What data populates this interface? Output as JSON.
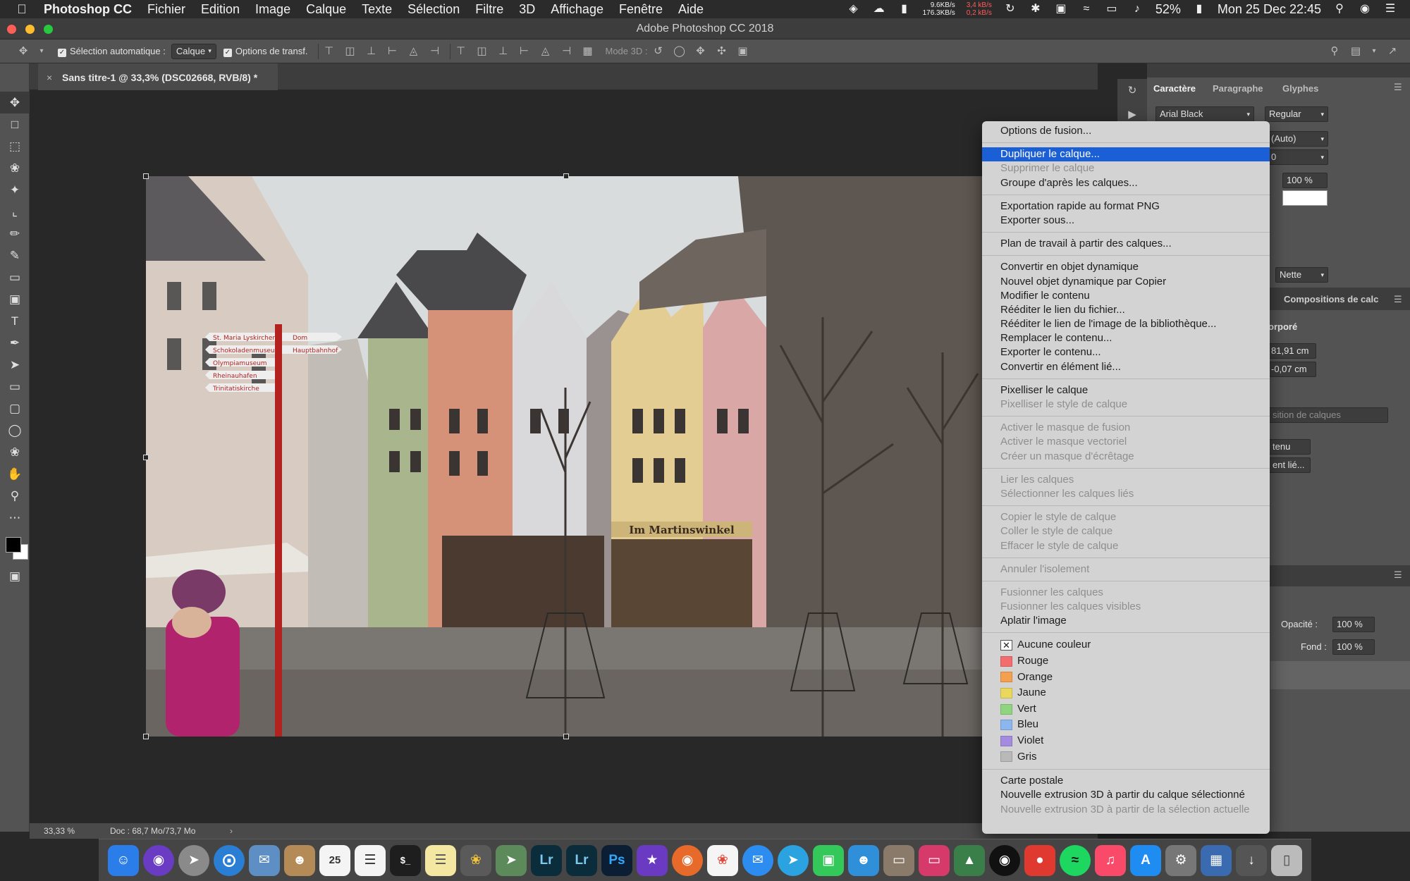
{
  "menubar": {
    "app_name": "Photoshop CC",
    "items": [
      "Fichier",
      "Edition",
      "Image",
      "Calque",
      "Texte",
      "Sélection",
      "Filtre",
      "3D",
      "Affichage",
      "Fenêtre",
      "Aide"
    ],
    "net_up": "9.6KB/s",
    "net_down": "176.3KB/s",
    "net_up2": "3,4 kB/s",
    "net_down2": "0,2 kB/s",
    "battery": "52%",
    "clock": "Mon 25 Dec  22:45"
  },
  "window": {
    "title": "Adobe Photoshop CC 2018"
  },
  "options_bar": {
    "auto_select_label": "Sélection automatique :",
    "auto_select_value": "Calque",
    "transform_label": "Options de transf.",
    "mode3d_label": "Mode 3D :"
  },
  "document": {
    "tab_title": "Sans titre-1 @ 33,3% (DSC02668, RVB/8) *",
    "close_glyph": "×"
  },
  "photo": {
    "sign_labels": [
      "St. Maria Lyskirchen",
      "Schokoladenmuseum",
      "Olympiamuseum",
      "Rheinauhafen",
      "Trinitatiskirche",
      "Dom",
      "Hauptbahnhof"
    ],
    "shop_sign": "Im Martinswinkel"
  },
  "statusbar": {
    "zoom": "33,33 %",
    "doc_info": "Doc : 68,7 Mo/73,7 Mo"
  },
  "panel": {
    "tabs": [
      "Caractère",
      "Paragraphe",
      "Glyphes"
    ],
    "font_family": "Arial Black",
    "font_style": "Regular",
    "leading": "(Auto)",
    "tracking": "0",
    "scale": "100 %",
    "antialias": "Nette",
    "comps_tab": "Compositions de calc",
    "incorporated_label": "orporé",
    "width_value": "81,91 cm",
    "offset_value": "-0,07 cm",
    "comp_select": "sition de calques",
    "content_btn": "tenu",
    "linked_btn": "ent lié...",
    "opacity_label": "Opacité :",
    "opacity_value": "100 %",
    "fill_label": "Fond :",
    "fill_value": "100 %"
  },
  "context_menu": {
    "items": [
      {
        "label": "Options de fusion...",
        "state": "normal"
      },
      {
        "sep": true
      },
      {
        "label": "Dupliquer le calque...",
        "state": "highlighted"
      },
      {
        "label": "Supprimer le calque",
        "state": "disabled"
      },
      {
        "label": "Groupe d'après les calques...",
        "state": "normal"
      },
      {
        "sep": true
      },
      {
        "label": "Exportation rapide au format PNG",
        "state": "normal"
      },
      {
        "label": "Exporter sous...",
        "state": "normal"
      },
      {
        "sep": true
      },
      {
        "label": "Plan de travail à partir des calques...",
        "state": "normal"
      },
      {
        "sep": true
      },
      {
        "label": "Convertir en objet dynamique",
        "state": "normal"
      },
      {
        "label": "Nouvel objet dynamique par Copier",
        "state": "normal"
      },
      {
        "label": "Modifier le contenu",
        "state": "normal"
      },
      {
        "label": "Rééditer le lien du fichier...",
        "state": "normal"
      },
      {
        "label": "Rééditer le lien de l'image de la bibliothèque...",
        "state": "normal"
      },
      {
        "label": "Remplacer le contenu...",
        "state": "normal"
      },
      {
        "label": "Exporter le contenu...",
        "state": "normal"
      },
      {
        "label": "Convertir en élément lié...",
        "state": "normal"
      },
      {
        "sep": true
      },
      {
        "label": "Pixelliser le calque",
        "state": "normal"
      },
      {
        "label": "Pixelliser le style de calque",
        "state": "disabled"
      },
      {
        "sep": true
      },
      {
        "label": "Activer le masque de fusion",
        "state": "disabled"
      },
      {
        "label": "Activer le masque vectoriel",
        "state": "disabled"
      },
      {
        "label": "Créer un masque d'écrêtage",
        "state": "disabled"
      },
      {
        "sep": true
      },
      {
        "label": "Lier les calques",
        "state": "disabled"
      },
      {
        "label": "Sélectionner les calques liés",
        "state": "disabled"
      },
      {
        "sep": true
      },
      {
        "label": "Copier le style de calque",
        "state": "disabled"
      },
      {
        "label": "Coller le style de calque",
        "state": "disabled"
      },
      {
        "label": "Effacer le style de calque",
        "state": "disabled"
      },
      {
        "sep": true
      },
      {
        "label": "Annuler l'isolement",
        "state": "disabled"
      },
      {
        "sep": true
      },
      {
        "label": "Fusionner les calques",
        "state": "disabled"
      },
      {
        "label": "Fusionner les calques visibles",
        "state": "disabled"
      },
      {
        "label": "Aplatir l'image",
        "state": "normal"
      },
      {
        "sep": true
      },
      {
        "color": "none",
        "label": "Aucune couleur",
        "swatch": "#ffffff"
      },
      {
        "color": "red",
        "label": "Rouge",
        "swatch": "#f26d6d"
      },
      {
        "color": "orange",
        "label": "Orange",
        "swatch": "#f4a04f"
      },
      {
        "color": "yellow",
        "label": "Jaune",
        "swatch": "#e9d85c"
      },
      {
        "color": "green",
        "label": "Vert",
        "swatch": "#8fd57f"
      },
      {
        "color": "blue",
        "label": "Bleu",
        "swatch": "#8bb6ee"
      },
      {
        "color": "violet",
        "label": "Violet",
        "swatch": "#a58be0"
      },
      {
        "color": "gray",
        "label": "Gris",
        "swatch": "#b9b9b9"
      },
      {
        "sep": true
      },
      {
        "label": "Carte postale",
        "state": "normal"
      },
      {
        "label": "Nouvelle extrusion 3D à partir du calque sélectionné",
        "state": "normal"
      },
      {
        "label": "Nouvelle extrusion 3D à partir de la sélection actuelle",
        "state": "disabled"
      }
    ]
  },
  "colors": {
    "menu_highlight": "#1a5fd6",
    "panel_bg": "#535353",
    "canvas_bg": "#282828"
  }
}
